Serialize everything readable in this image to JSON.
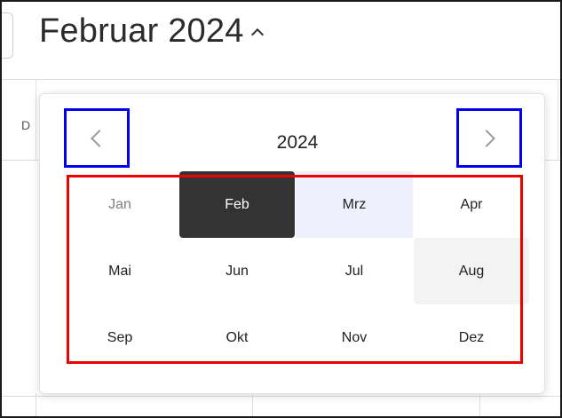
{
  "header": {
    "title": "Februar 2024"
  },
  "calendar": {
    "day_initial": "D"
  },
  "picker": {
    "year": "2024",
    "months": [
      {
        "label": "Jan",
        "state": "disabled"
      },
      {
        "label": "Feb",
        "state": "selected"
      },
      {
        "label": "Mrz",
        "state": "range"
      },
      {
        "label": "Apr",
        "state": "normal"
      },
      {
        "label": "Mai",
        "state": "normal"
      },
      {
        "label": "Jun",
        "state": "normal"
      },
      {
        "label": "Jul",
        "state": "normal"
      },
      {
        "label": "Aug",
        "state": "hover"
      },
      {
        "label": "Sep",
        "state": "normal"
      },
      {
        "label": "Okt",
        "state": "normal"
      },
      {
        "label": "Nov",
        "state": "normal"
      },
      {
        "label": "Dez",
        "state": "normal"
      }
    ]
  },
  "icons": {
    "prev": "chevron-left-icon",
    "next": "chevron-right-icon",
    "toggle": "caret-up-icon"
  },
  "colors": {
    "selected_bg": "#333333",
    "range_bg": "#eef0fc",
    "hover_bg": "#f3f3f3",
    "nav_highlight": "#0000ee",
    "grid_highlight": "#ee0000"
  }
}
